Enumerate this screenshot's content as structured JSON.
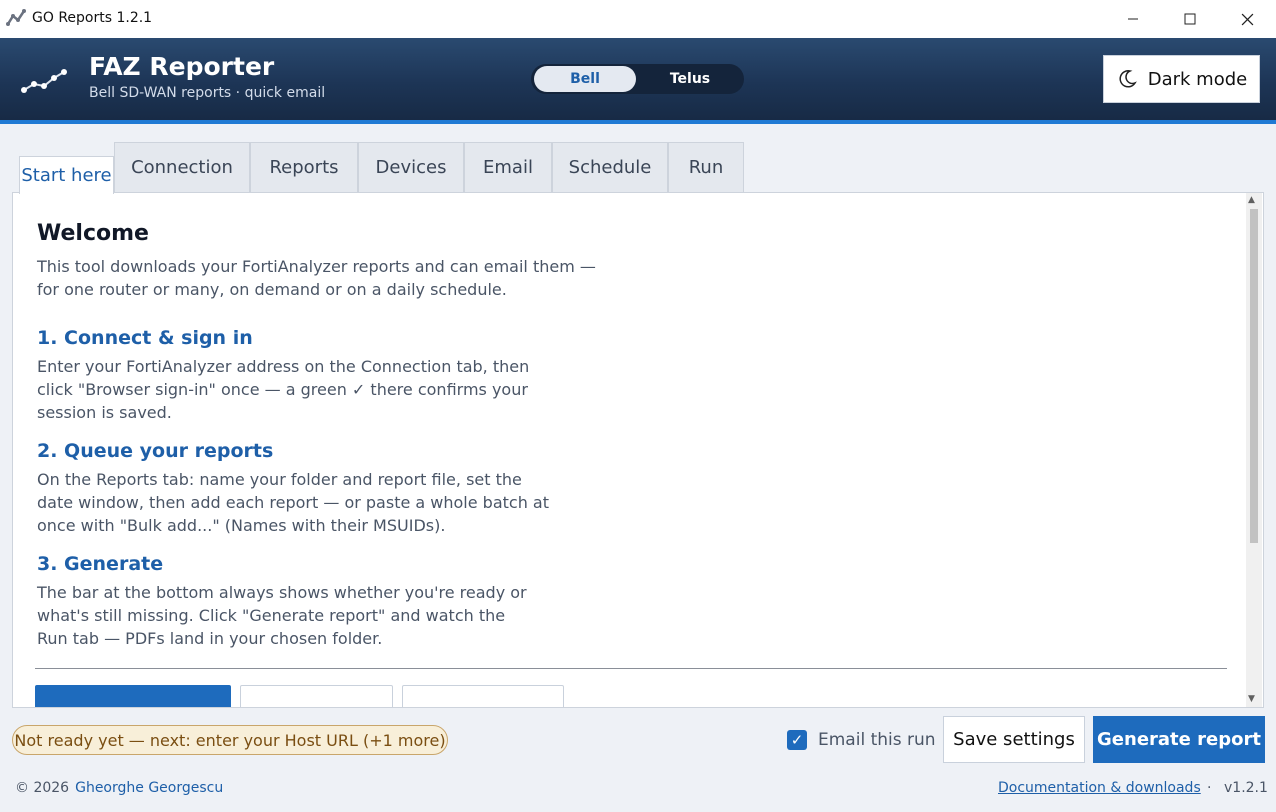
{
  "window": {
    "title": "GO Reports 1.2.1",
    "controls": [
      "minimize",
      "maximize",
      "close"
    ]
  },
  "header": {
    "title": "FAZ Reporter",
    "subtitle": "Bell SD-WAN reports · quick email",
    "toggle": {
      "options": [
        "Bell",
        "Telus"
      ],
      "selected": "Bell"
    },
    "dark_mode_label": "Dark mode",
    "accent_color": "#1f7ad4"
  },
  "tabs": [
    {
      "label": "Start here",
      "active": true
    },
    {
      "label": "Connection",
      "active": false
    },
    {
      "label": "Reports",
      "active": false
    },
    {
      "label": "Devices",
      "active": false
    },
    {
      "label": "Email",
      "active": false
    },
    {
      "label": "Schedule",
      "active": false
    },
    {
      "label": "Run",
      "active": false
    }
  ],
  "content": {
    "heading": "Welcome",
    "intro": "This tool downloads your FortiAnalyzer reports and can email them —\nfor one router or many, on demand or on a daily schedule.",
    "steps": [
      {
        "title": "1.  Connect & sign in",
        "body": "Enter your FortiAnalyzer address on the Connection tab, then\nclick \"Browser sign-in\" once — a green ✓ there confirms your\nsession is saved."
      },
      {
        "title": "2.  Queue your reports",
        "body": "On the Reports tab: name your folder and report file, set the\ndate window, then add each report — or paste a whole batch at\nonce with \"Bulk add...\" (Names with their MSUIDs)."
      },
      {
        "title": "3.  Generate",
        "body": "The bar at the bottom always shows whether you're ready or\nwhat's still missing. Click \"Generate report\" and watch the\nRun tab — PDFs land in your chosen folder."
      }
    ]
  },
  "statusbar": {
    "status_text": "Not ready yet — next: enter your Host URL  (+1 more)",
    "email_checkbox_label": "Email this run",
    "email_checked": true,
    "save_label": "Save settings",
    "generate_label": "Generate report",
    "primary_color": "#1e6bbd",
    "warning_color": "#f8efd9"
  },
  "footer": {
    "copyright": "© 2026",
    "author": "Gheorghe Georgescu",
    "docs_link": "Documentation & downloads",
    "separator": "·",
    "version": "v1.2.1"
  }
}
